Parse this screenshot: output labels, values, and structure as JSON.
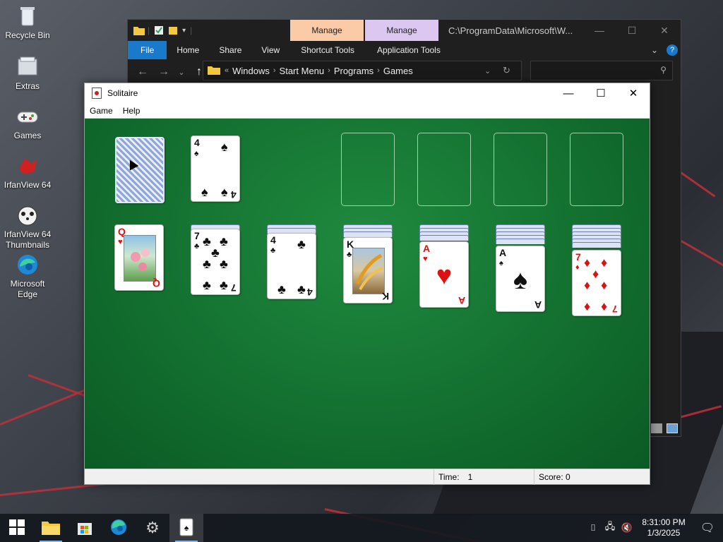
{
  "desktop": {
    "icons": [
      {
        "label": "Recycle Bin",
        "icon": "recycle-bin-icon"
      },
      {
        "label": "Extras",
        "icon": "extras-icon"
      },
      {
        "label": "Games",
        "icon": "gamepad-icon"
      },
      {
        "label": "IrfanView 64",
        "icon": "irfanview-icon"
      },
      {
        "label": "IrfanView 64 Thumbnails",
        "icon": "irfanview-thumbnails-icon"
      },
      {
        "label": "Microsoft Edge",
        "icon": "edge-icon"
      }
    ]
  },
  "explorer": {
    "context_tab_1": "Manage",
    "context_tab_2": "Manage",
    "title_path": "C:\\ProgramData\\Microsoft\\W...",
    "ribbon_tabs": [
      "File",
      "Home",
      "Share",
      "View",
      "Shortcut Tools",
      "Application Tools"
    ],
    "breadcrumb": [
      "Windows",
      "Start Menu",
      "Programs",
      "Games"
    ],
    "colors": {
      "file_tab": "#1979ca",
      "manage_1": "#fbcaa6",
      "manage_2": "#dcc7f0"
    }
  },
  "solitaire": {
    "title": "Solitaire",
    "menu": [
      "Game",
      "Help"
    ],
    "status": {
      "time_label": "Time:",
      "time_value": "1",
      "score_label": "Score: 0"
    },
    "stock_waste": {
      "waste_card": {
        "rank": "4",
        "suit": "♠"
      }
    },
    "tableau": [
      {
        "rank": "Q",
        "suit": "♥",
        "face_down": 0
      },
      {
        "rank": "7",
        "suit": "♣",
        "face_down": 1
      },
      {
        "rank": "4",
        "suit": "♣",
        "face_down": 2
      },
      {
        "rank": "K",
        "suit": "♣",
        "face_down": 3
      },
      {
        "rank": "A",
        "suit": "♥",
        "face_down": 4
      },
      {
        "rank": "A",
        "suit": "♠",
        "face_down": 5
      },
      {
        "rank": "7",
        "suit": "♦",
        "face_down": 6
      }
    ],
    "colors": {
      "felt": "#137030"
    }
  },
  "taskbar": {
    "apps": [
      "start-icon",
      "file-explorer-icon",
      "store-icon",
      "edge-icon",
      "settings-icon",
      "solitaire-icon"
    ],
    "clock_time": "8:31:00 PM",
    "clock_date": "1/3/2025"
  }
}
